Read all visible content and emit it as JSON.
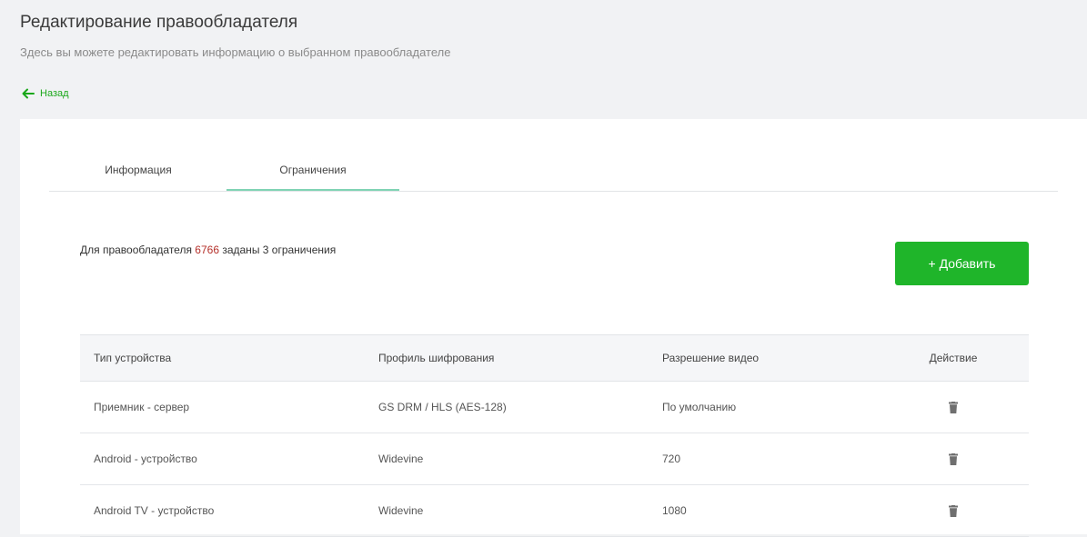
{
  "header": {
    "title": "Редактирование правообладателя",
    "subtitle": "Здесь вы можете редактировать информацию о выбранном правообладателе",
    "back_label": "Назад"
  },
  "tabs": [
    {
      "label": "Информация",
      "active": false
    },
    {
      "label": "Ограничения",
      "active": true
    }
  ],
  "summary": {
    "prefix": "Для правообладателя ",
    "id": "6766",
    "suffix": " заданы 3 ограничения"
  },
  "add_button": {
    "label": "+ Добавить"
  },
  "table": {
    "columns": [
      "Тип устройства",
      "Профиль шифрования",
      "Разрешение видео",
      "Действие"
    ],
    "rows": [
      {
        "device": "Приемник - сервер",
        "profile": "GS DRM / HLS (AES-128)",
        "resolution": "По умолчанию",
        "action_icon": "trash-icon"
      },
      {
        "device": "Android - устройство",
        "profile": "Widevine",
        "resolution": "720",
        "action_icon": "trash-icon"
      },
      {
        "device": "Android TV - устройство",
        "profile": "Widevine",
        "resolution": "1080",
        "action_icon": "trash-icon"
      }
    ]
  },
  "colors": {
    "accent_green": "#1fb52a",
    "back_green": "#1aa71a",
    "highlight_red": "#b5302a",
    "tab_underline": "#7fd3b4"
  }
}
